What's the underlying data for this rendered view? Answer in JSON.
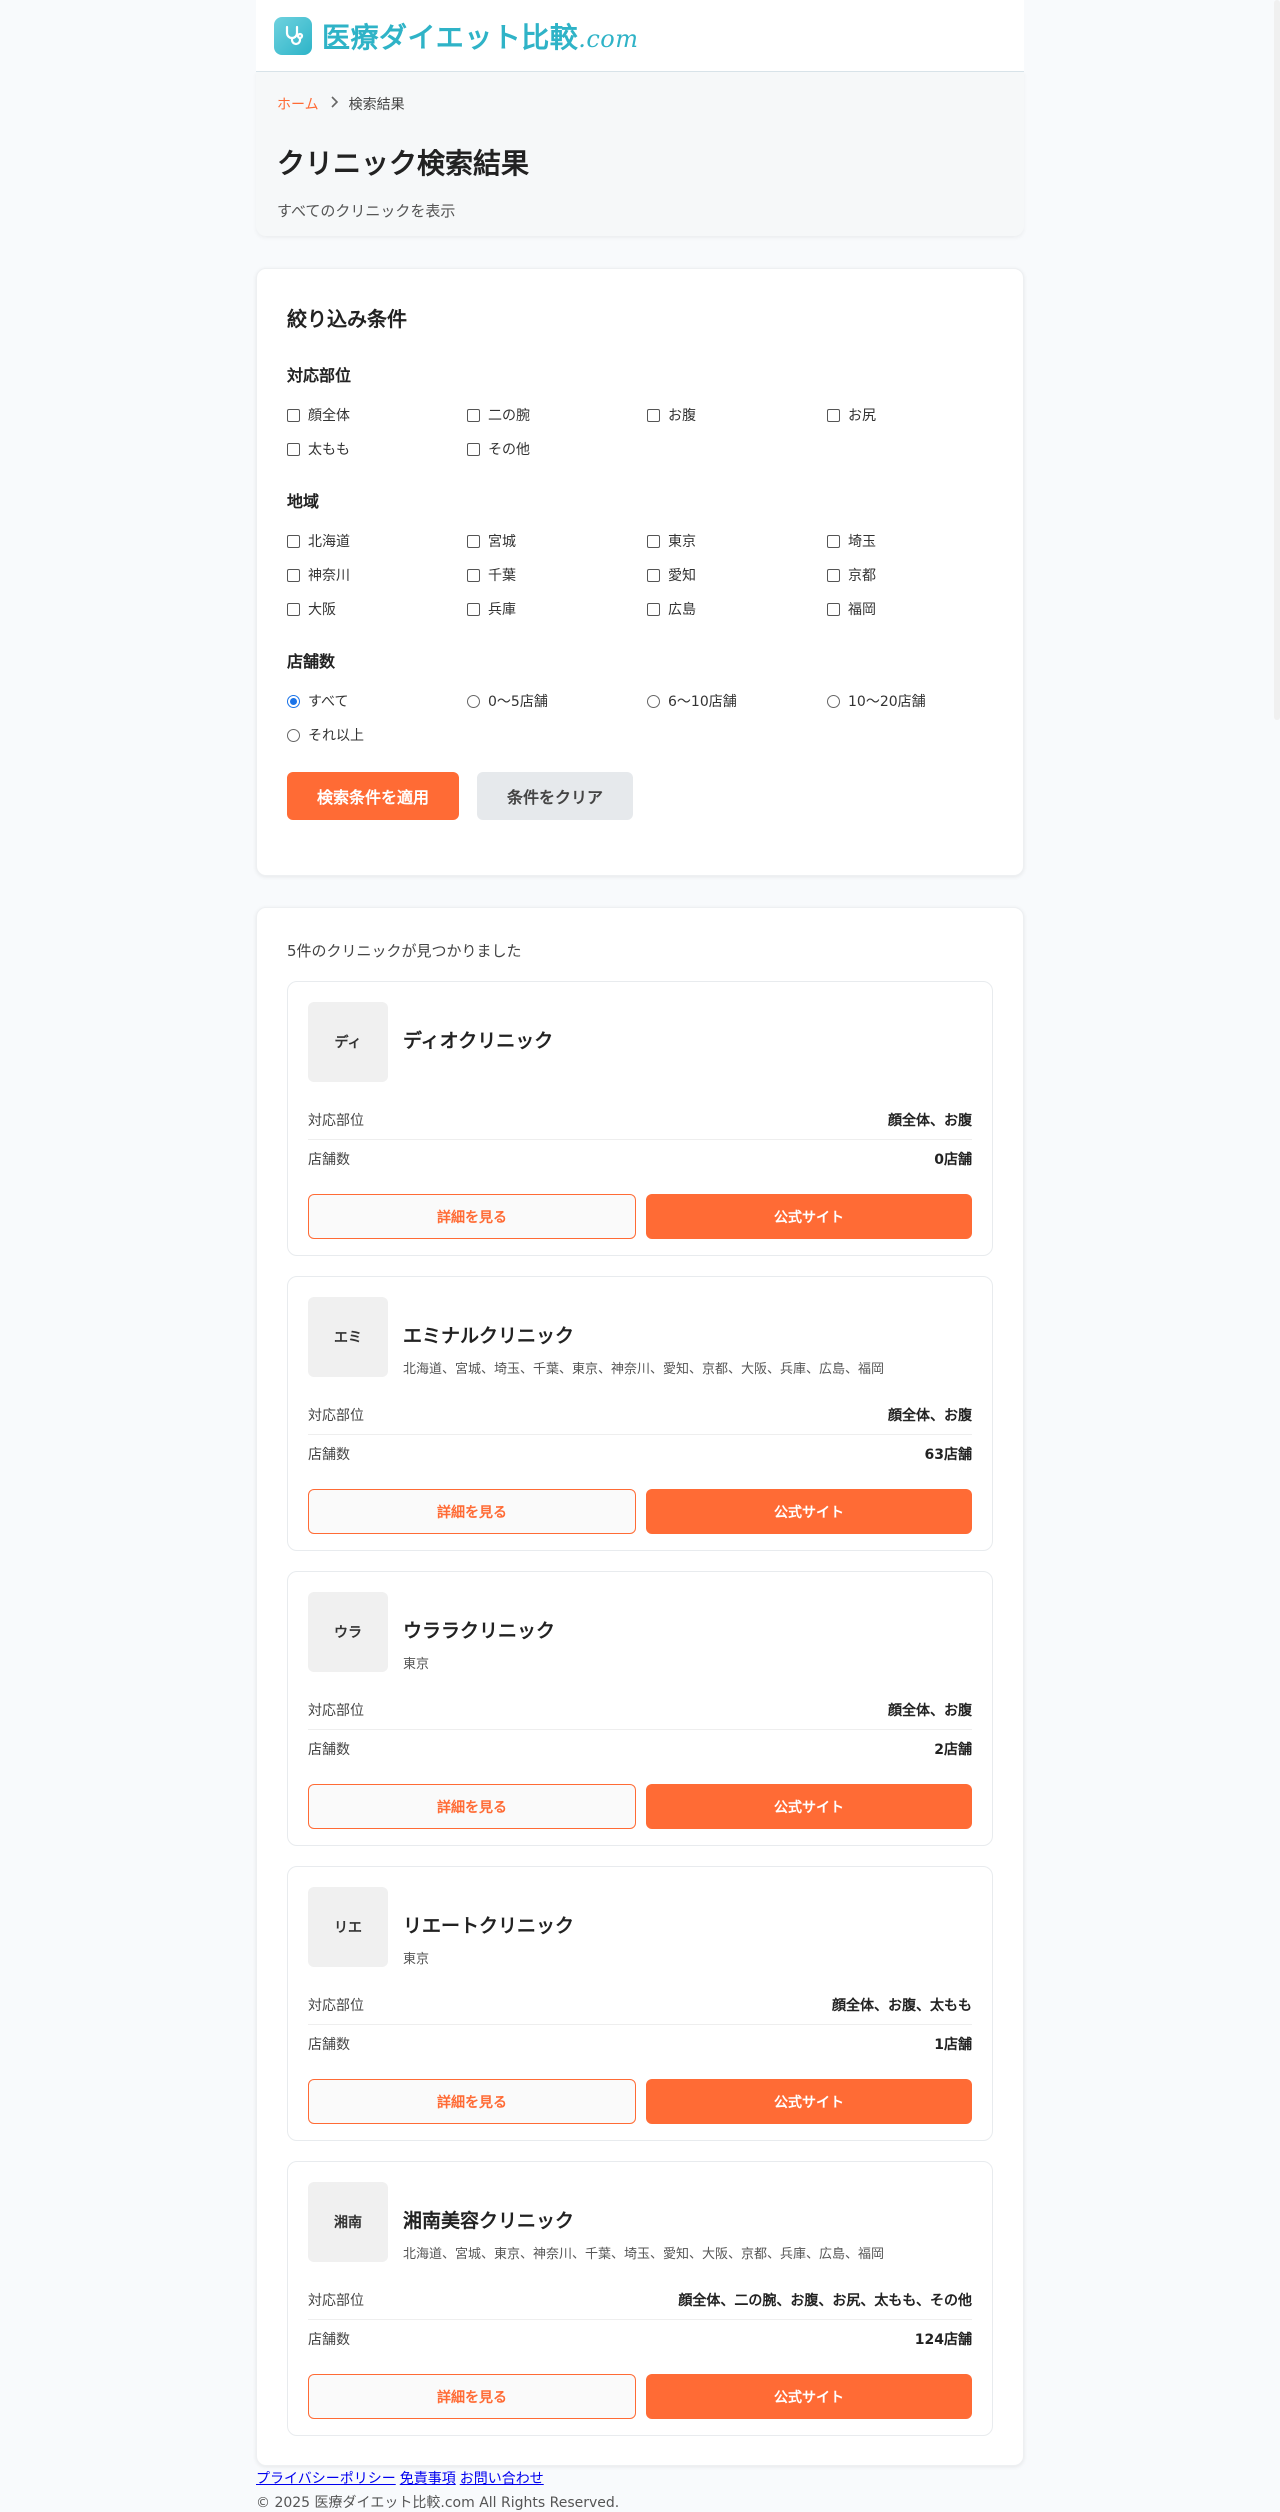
{
  "site": {
    "logo_icon": "stethoscope-icon",
    "logo_main": "医療ダイエット比較",
    "logo_domain": ".com"
  },
  "breadcrumb": {
    "home": "ホーム",
    "current": "検索結果"
  },
  "hero": {
    "title": "クリニック検索結果",
    "subtitle": "すべてのクリニックを表示"
  },
  "filter": {
    "title": "絞り込み条件",
    "parts": {
      "label": "対応部位",
      "options": [
        "顔全体",
        "二の腕",
        "お腹",
        "お尻",
        "太もも",
        "その他"
      ]
    },
    "regions": {
      "label": "地域",
      "options": [
        "北海道",
        "宮城",
        "東京",
        "埼玉",
        "神奈川",
        "千葉",
        "愛知",
        "京都",
        "大阪",
        "兵庫",
        "広島",
        "福岡"
      ]
    },
    "stores": {
      "label": "店舗数",
      "options": [
        "すべて",
        "0〜5店舗",
        "6〜10店舗",
        "10〜20店舗",
        "それ以上"
      ],
      "selected": "すべて"
    },
    "apply_label": "検索条件を適用",
    "clear_label": "条件をクリア"
  },
  "results": {
    "count_text": "5件のクリニックが見つかりました",
    "parts_label": "対応部位",
    "stores_label": "店舗数",
    "detail_label": "詳細を見る",
    "official_label": "公式サイト",
    "clinics": [
      {
        "abbr": "ディ",
        "name": "ディオクリニック",
        "areas": "",
        "parts": "顔全体、お腹",
        "stores": "0店舗"
      },
      {
        "abbr": "エミ",
        "name": "エミナルクリニック",
        "areas": "北海道、宮城、埼玉、千葉、東京、神奈川、愛知、京都、大阪、兵庫、広島、福岡",
        "parts": "顔全体、お腹",
        "stores": "63店舗"
      },
      {
        "abbr": "ウラ",
        "name": "ウララクリニック",
        "areas": "東京",
        "parts": "顔全体、お腹",
        "stores": "2店舗"
      },
      {
        "abbr": "リエ",
        "name": "リエートクリニック",
        "areas": "東京",
        "parts": "顔全体、お腹、太もも",
        "stores": "1店舗"
      },
      {
        "abbr": "湘南",
        "name": "湘南美容クリニック",
        "areas": "北海道、宮城、東京、神奈川、千葉、埼玉、愛知、大阪、京都、兵庫、広島、福岡",
        "parts": "顔全体、二の腕、お腹、お尻、太もも、その他",
        "stores": "124店舗"
      }
    ]
  },
  "footer": {
    "links": [
      "プライバシーポリシー",
      "免責事項",
      "お問い合わせ"
    ],
    "copyright": "© 2025 医療ダイエット比較.com All Rights Reserved."
  },
  "colors": {
    "accent": "#ff6b35",
    "logo": "#2fb3c7",
    "radio_checked": "#1a73e8"
  }
}
